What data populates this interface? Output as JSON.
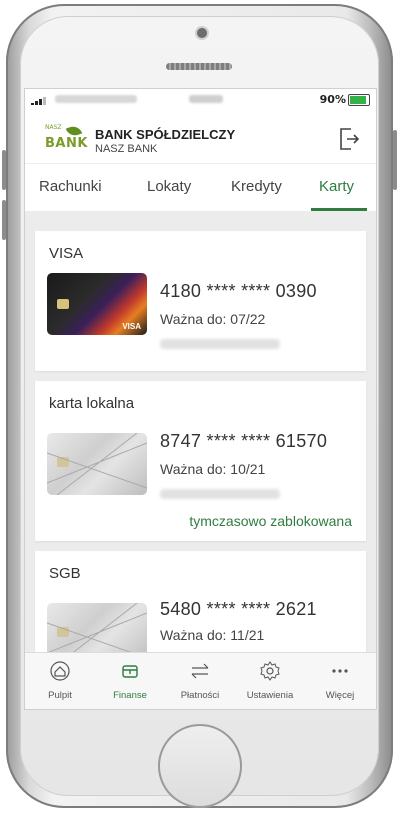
{
  "statusbar": {
    "battery_text": "90%"
  },
  "header": {
    "logo_top": "NASZ",
    "logo_bottom": "BANK",
    "bank_name": "BANK SPÓŁDZIELCZY",
    "bank_sub": "NASZ BANK"
  },
  "tabs": [
    {
      "label": "Rachunki",
      "active": false
    },
    {
      "label": "Lokaty",
      "active": false
    },
    {
      "label": "Kredyty",
      "active": false
    },
    {
      "label": "Karty",
      "active": true
    }
  ],
  "cards": [
    {
      "title": "VISA",
      "number": "4180 **** **** 0390",
      "valid": "Ważna do: 07/22",
      "image": "visa-card-image"
    },
    {
      "title": "karta lokalna",
      "number": "8747 **** **** 61570",
      "valid": "Ważna do: 10/21",
      "status": "tymczasowo zablokowana",
      "image": "local-card-image"
    },
    {
      "title": "SGB",
      "number": "5480 **** **** 2621",
      "valid": "Ważna do: 11/21",
      "image": "sgb-card-image"
    }
  ],
  "nav": [
    {
      "label": "Pulpit",
      "icon": "home-icon",
      "active": false
    },
    {
      "label": "Finanse",
      "icon": "wallet-icon",
      "active": true
    },
    {
      "label": "Płatności",
      "icon": "transfer-arrows-icon",
      "active": false
    },
    {
      "label": "Ustawienia",
      "icon": "gear-icon",
      "active": false
    },
    {
      "label": "Więcej",
      "icon": "more-dots-icon",
      "active": false
    }
  ],
  "colors": {
    "accent": "#2f7d3f",
    "logo": "#7a9d2a"
  }
}
